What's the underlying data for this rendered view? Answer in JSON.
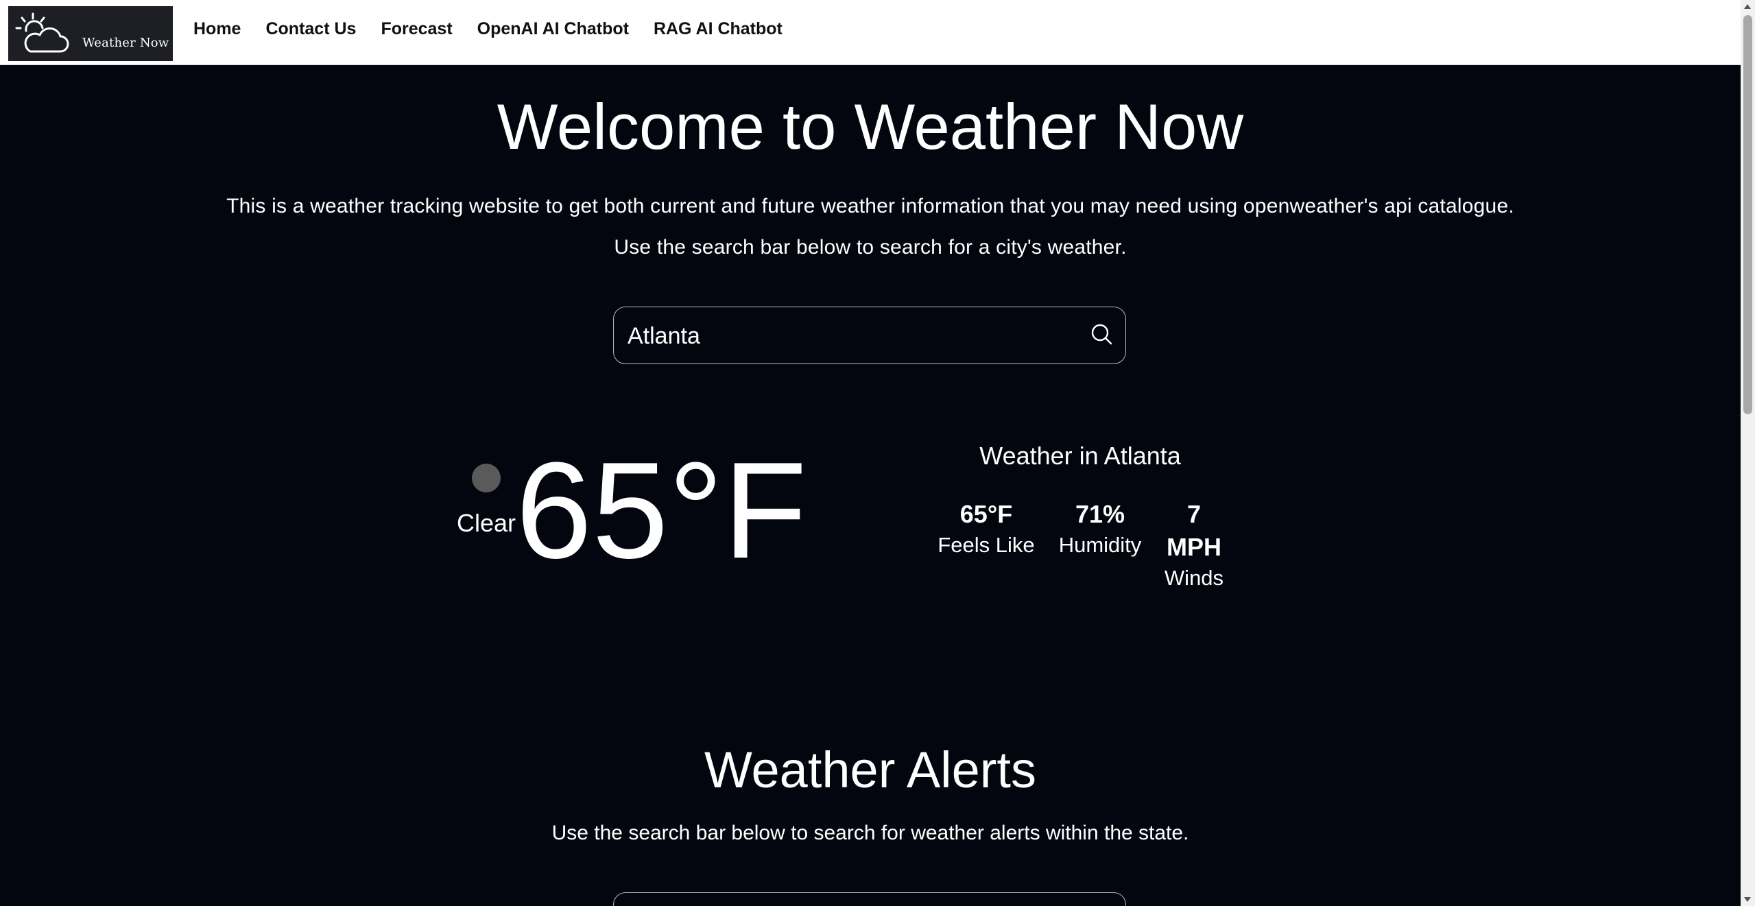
{
  "nav": {
    "logo_text": "Weather Now",
    "links": [
      "Home",
      "Contact Us",
      "Forecast",
      "OpenAI AI Chatbot",
      "RAG AI Chatbot"
    ]
  },
  "welcome": {
    "title": "Welcome to Weather Now",
    "intro_1": "This is a weather tracking website to get both current and future weather information that you may need using openweather's api catalogue.",
    "intro_2": "Use the search bar below to search for a city's weather."
  },
  "search": {
    "value": "Atlanta",
    "icon": "search-icon"
  },
  "current": {
    "condition": "Clear",
    "temperature": "65°F",
    "location_title": "Weather in Atlanta",
    "feels_like_value": "65°F",
    "feels_like_label": "Feels Like",
    "humidity_value": "71%",
    "humidity_label": "Humidity",
    "wind_value_number": "7",
    "wind_value_unit": "MPH",
    "wind_label": "Winds"
  },
  "alerts": {
    "title": "Weather Alerts",
    "intro": "Use the search bar below to search for weather alerts within the state."
  },
  "colors": {
    "background": "#03060f",
    "navbar": "#ffffff",
    "logo_bg": "#1d1f25",
    "text": "#ffffff"
  }
}
